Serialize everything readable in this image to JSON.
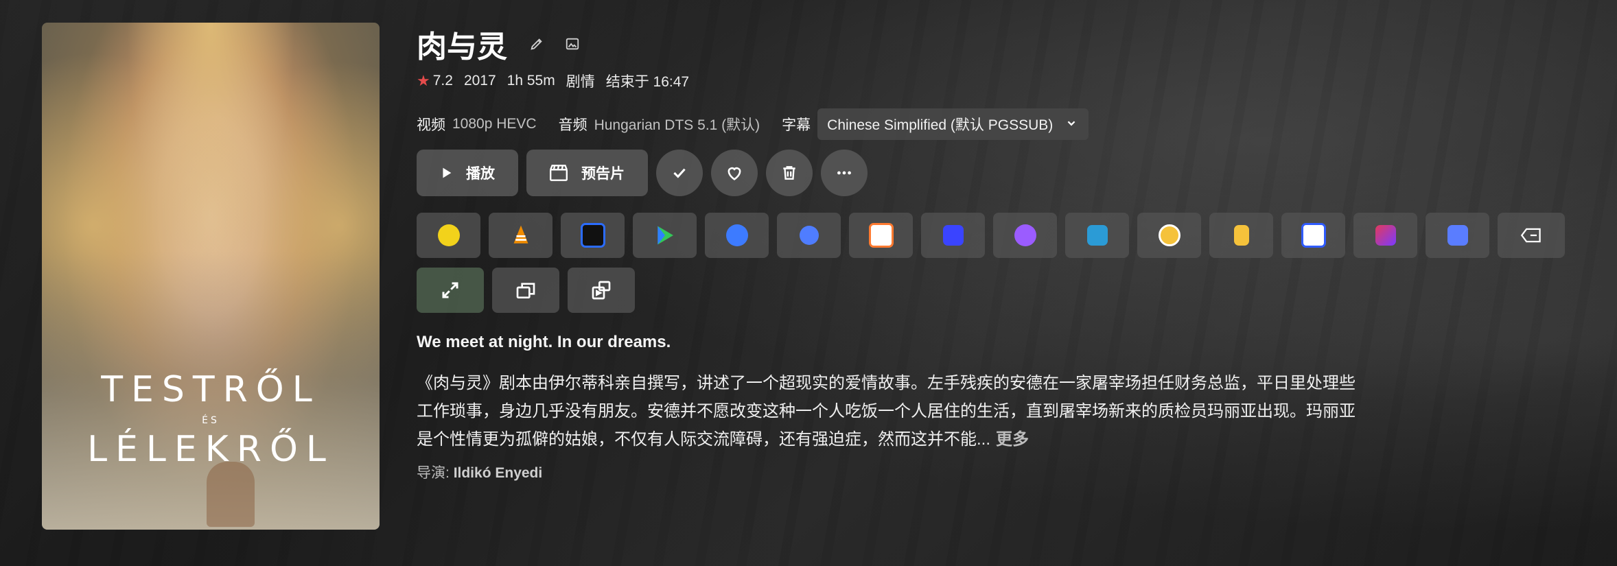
{
  "poster": {
    "line1": "TESTRŐL",
    "line2": "ÉS",
    "line3": "LÉLEKRŐL"
  },
  "title": "肉与灵",
  "meta": {
    "rating": "7.2",
    "year": "2017",
    "runtime": "1h 55m",
    "genre": "剧情",
    "ends_at": "结束于 16:47"
  },
  "streams": {
    "video_label": "视频",
    "video_value": "1080p HEVC",
    "audio_label": "音频",
    "audio_value": "Hungarian DTS 5.1 (默认)",
    "subtitle_label": "字幕",
    "subtitle_value": "Chinese Simplified (默认 PGSSUB)"
  },
  "actions": {
    "play": "播放",
    "trailer": "预告片"
  },
  "players": [
    {
      "name": "player-1",
      "color": "#f2d21b"
    },
    {
      "name": "vlc",
      "color": "#f08c00"
    },
    {
      "name": "player-3",
      "color": "#2b6cff"
    },
    {
      "name": "player-4",
      "color": "#34c759"
    },
    {
      "name": "player-5",
      "color": "#3d7bff"
    },
    {
      "name": "player-6",
      "color": "#4f7dff"
    },
    {
      "name": "player-7",
      "color": "#ff7a30"
    },
    {
      "name": "player-8",
      "color": "#3a44ff"
    },
    {
      "name": "player-9",
      "color": "#9b5cff"
    },
    {
      "name": "player-10",
      "color": "#2b9bd6"
    },
    {
      "name": "player-11",
      "color": "#f5c23b"
    },
    {
      "name": "player-12",
      "color": "#f5c23b"
    },
    {
      "name": "player-13",
      "color": "#2f5bff"
    },
    {
      "name": "player-14",
      "color": "#e23a5c"
    },
    {
      "name": "player-15",
      "color": "#5a7dff"
    }
  ],
  "tagline": "We meet at night. In our dreams.",
  "overview": "《肉与灵》剧本由伊尔蒂科亲自撰写，讲述了一个超现实的爱情故事。左手残疾的安德在一家屠宰场担任财务总监，平日里处理些工作琐事，身边几乎没有朋友。安德并不愿改变这种一个人吃饭一个人居住的生活，直到屠宰场新来的质检员玛丽亚出现。玛丽亚是个性情更为孤僻的姑娘，不仅有人际交流障碍，还有强迫症，然而这并不能...",
  "more_label": "更多",
  "director": {
    "label": "导演:",
    "name": "Ildikó Enyedi"
  }
}
